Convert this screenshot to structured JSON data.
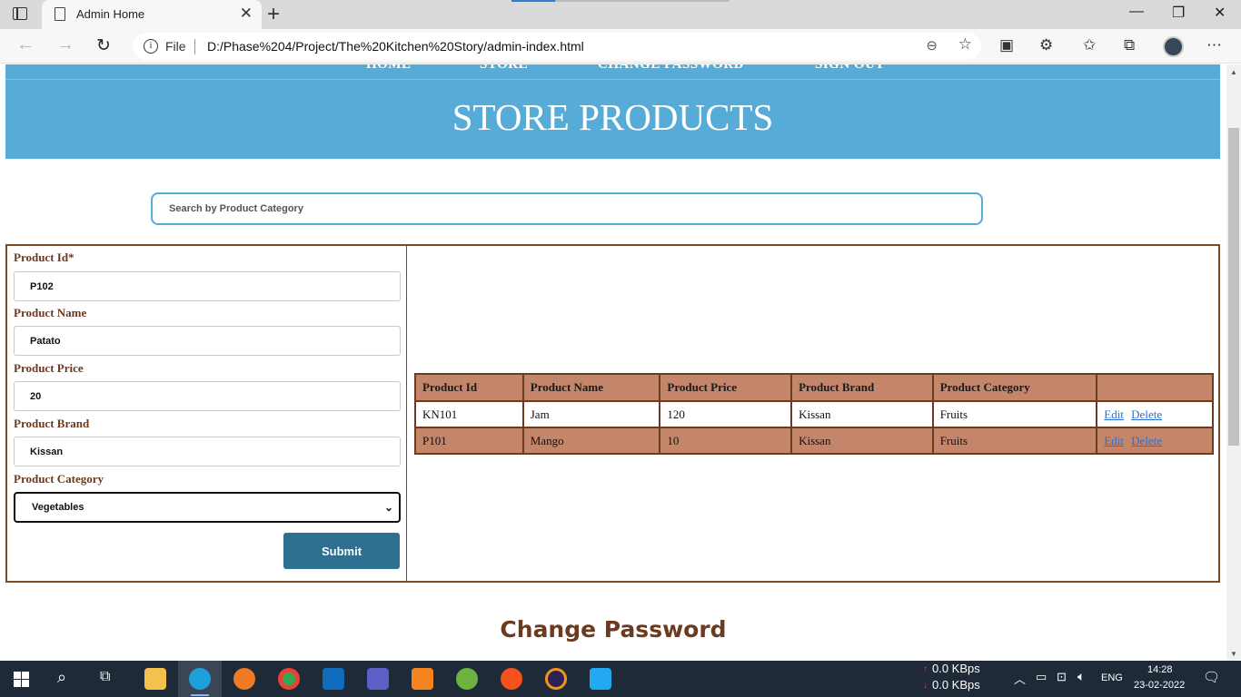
{
  "browser": {
    "tab_title": "Admin Home",
    "file_label": "File",
    "url": "D:/Phase%204/Project/The%20Kitchen%20Story/admin-index.html"
  },
  "nav": {
    "home": "HOME",
    "store": "STORE",
    "change_password": "CHANGE PASSWORD",
    "sign_out": "SIGN OUT"
  },
  "page_title": "STORE PRODUCTS",
  "search": {
    "placeholder": "Search by Product Category"
  },
  "form": {
    "product_id_label": "Product Id*",
    "product_id_value": "P102",
    "product_name_label": "Product Name",
    "product_name_value": "Patato",
    "product_price_label": "Product Price",
    "product_price_value": "20",
    "product_brand_label": "Product Brand",
    "product_brand_value": "Kissan",
    "product_category_label": "Product Category",
    "product_category_value": "Vegetables",
    "submit_label": "Submit"
  },
  "table": {
    "headers": [
      "Product Id",
      "Product Name",
      "Product Price",
      "Product Brand",
      "Product Category",
      ""
    ],
    "rows": [
      {
        "id": "KN101",
        "name": "Jam",
        "price": "120",
        "brand": "Kissan",
        "category": "Fruits",
        "edit": "Edit",
        "delete": "Delete"
      },
      {
        "id": "P101",
        "name": "Mango",
        "price": "10",
        "brand": "Kissan",
        "category": "Fruits",
        "edit": "Edit",
        "delete": "Delete"
      }
    ]
  },
  "change_password_heading": "Change Password",
  "taskbar": {
    "net_up": "0.0 KBps",
    "net_down": "0.0 KBps",
    "language": "ENG",
    "time": "14:28",
    "date": "23-02-2022"
  },
  "colors": {
    "header_blue": "#56acd7",
    "brown": "#6b3a1f",
    "row_tan": "#c3866b",
    "submit_teal": "#2f6f8f"
  }
}
